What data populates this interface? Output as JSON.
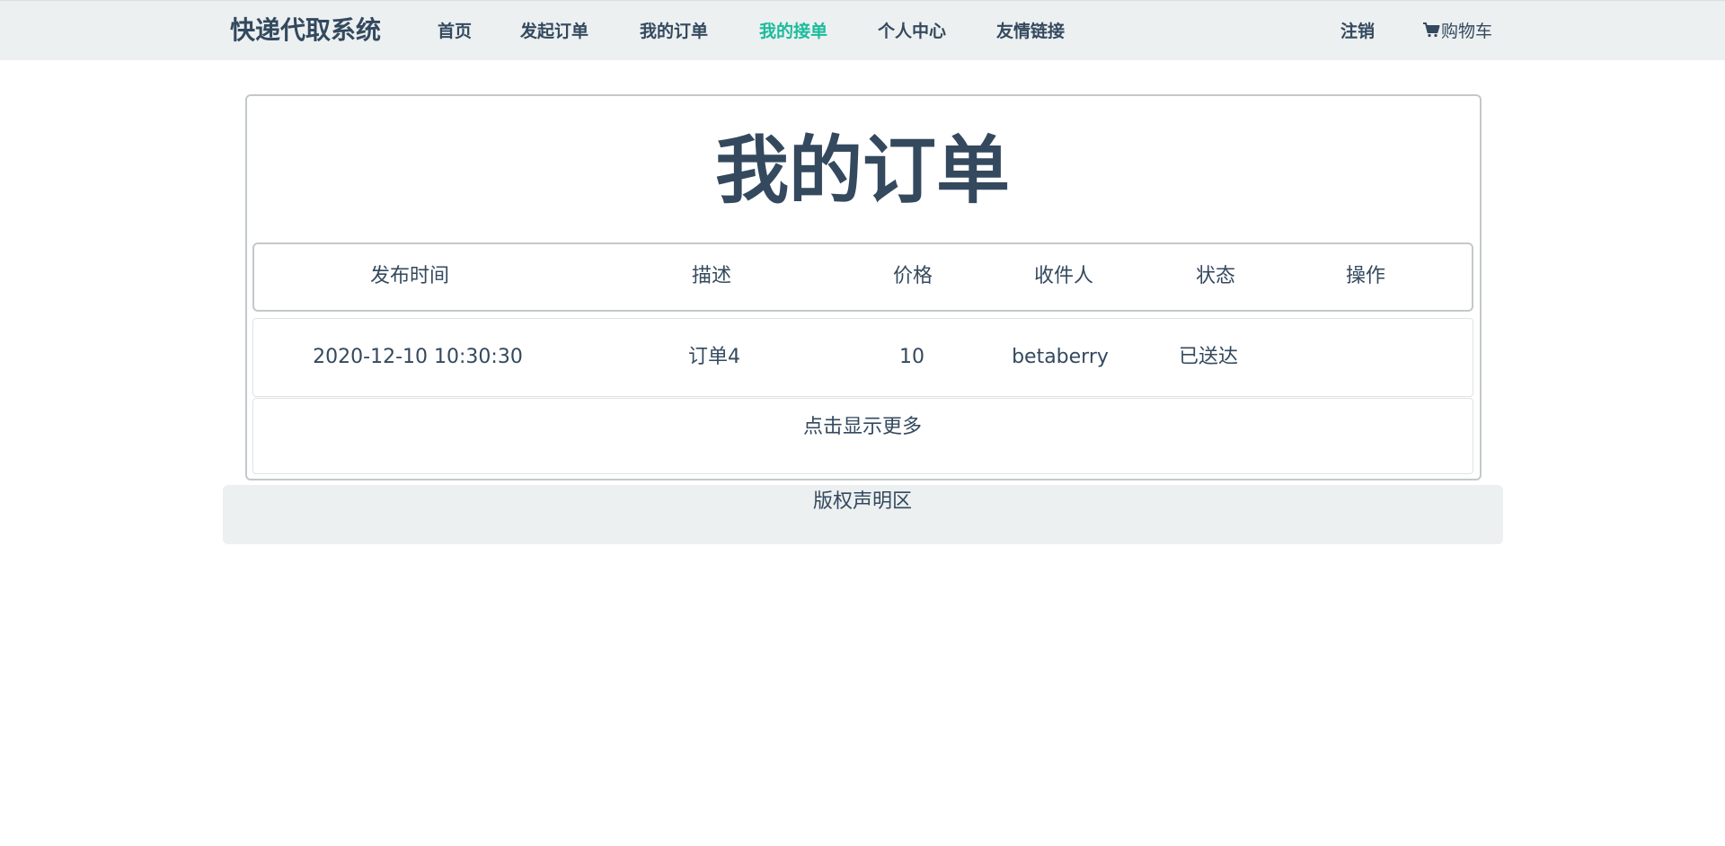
{
  "navbar": {
    "brand": "快递代取系统",
    "items": [
      {
        "label": "首页"
      },
      {
        "label": "发起订单"
      },
      {
        "label": "我的订单"
      },
      {
        "label": "我的接单"
      },
      {
        "label": "个人中心"
      },
      {
        "label": "友情链接"
      }
    ],
    "active_item": "我的接单",
    "logout_label": "注销",
    "cart_label": "购物车",
    "cart_icon": "cart-icon",
    "active_color": "#1abc9c",
    "text_color": "#34495e",
    "background_color": "#ecf0f1"
  },
  "main": {
    "title": "我的订单",
    "table": {
      "columns": [
        "发布时间",
        "描述",
        "价格",
        "收件人",
        "状态",
        "操作"
      ],
      "rows": [
        {
          "publish_time": "2020-12-10 10:30:30",
          "description": "订单4",
          "price": "10",
          "recipient": "betaberry",
          "status": "已送达",
          "action": ""
        }
      ]
    },
    "show_more_label": "点击显示更多"
  },
  "footer": {
    "text": "版权声明区"
  }
}
